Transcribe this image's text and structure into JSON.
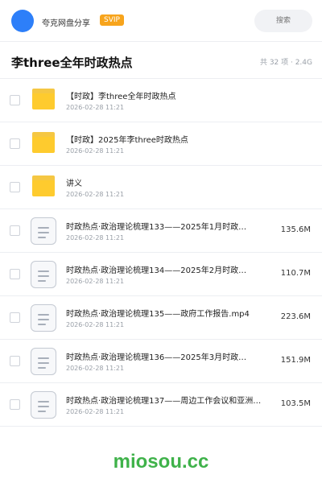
{
  "topbar": {
    "share_title": "夸克网盘分享",
    "svip_badge": "SVIP",
    "search_placeholder": "搜索"
  },
  "folder": {
    "title": "李three全年时政热点",
    "meta": "共 32 项 · 2.4G"
  },
  "files": [
    {
      "type": "folder",
      "name": "【时政】李three全年时政热点",
      "date": "2026-02-28 11:21",
      "size": ""
    },
    {
      "type": "folder",
      "name": "【时政】2025年李three时政热点",
      "date": "2026-02-28 11:21",
      "size": ""
    },
    {
      "type": "folder",
      "name": "讲义",
      "date": "2026-02-28 11:21",
      "size": ""
    },
    {
      "type": "file",
      "name": "时政热点·政治理论梳理133——2025年1月时政…",
      "date": "2026-02-28 11:21",
      "size": "135.6M"
    },
    {
      "type": "file",
      "name": "时政热点·政治理论梳理134——2025年2月时政…",
      "date": "2026-02-28 11:21",
      "size": "110.7M"
    },
    {
      "type": "file",
      "name": "时政热点·政治理论梳理135——政府工作报告.mp4",
      "date": "2026-02-28 11:21",
      "size": "223.6M"
    },
    {
      "type": "file",
      "name": "时政热点·政治理论梳理136——2025年3月时政…",
      "date": "2026-02-28 11:21",
      "size": "151.9M"
    },
    {
      "type": "file",
      "name": "时政热点·政治理论梳理137——周边工作会议和亚洲…",
      "date": "2026-02-28 11:21",
      "size": "103.5M"
    }
  ],
  "watermark": "miosou.cc",
  "colors": {
    "avatar": "#2d7ff9",
    "svip": "#f7a41c",
    "folder": "#fecb2e",
    "watermark": "#3fb24a"
  }
}
